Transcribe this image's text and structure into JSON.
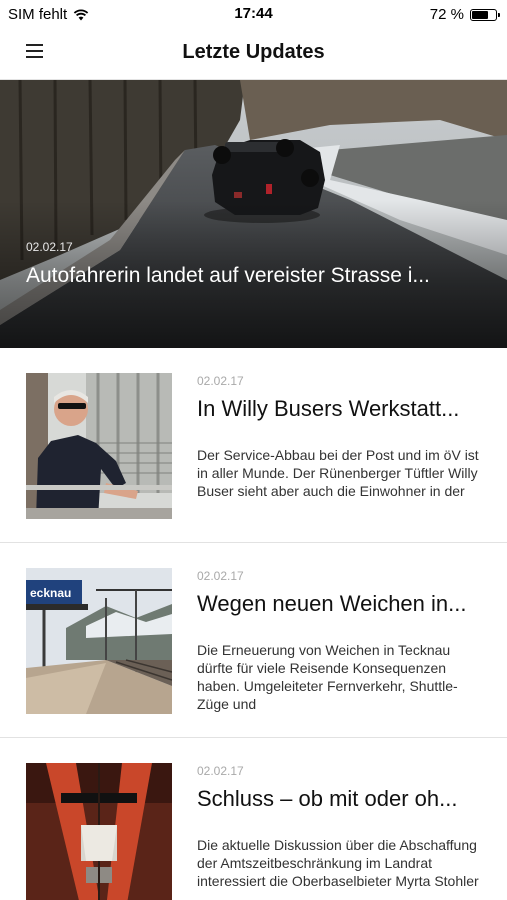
{
  "status_bar": {
    "carrier": "SIM fehlt",
    "time": "17:44",
    "battery": "72 %",
    "battery_level": 0.72,
    "icons": [
      "wifi-icon",
      "battery-icon"
    ]
  },
  "nav": {
    "title": "Letzte Updates",
    "menu_icon": "hamburger-menu-icon"
  },
  "hero": {
    "date": "02.02.17",
    "title": "Autofahrerin landet auf vereister Strasse i..."
  },
  "articles": [
    {
      "date": "02.02.17",
      "title": "In Willy Busers Werkstatt...",
      "text": "Der Service-Abbau bei der Post und im öV ist in aller Munde. Der Rünenberger Tüftler Willy Buser sieht aber auch die Einwohner in der"
    },
    {
      "date": "02.02.17",
      "title": "Wegen neuen Weichen in...",
      "text": "Die Erneuerung von Weichen in Tecknau dürfte für viele Reisende Konsequenzen haben. Umgeleiteter Fernverkehr, Shuttle-Züge und"
    },
    {
      "date": "02.02.17",
      "title": "Schluss – ob mit oder oh...",
      "text": "Die aktuelle Diskussion über die Abschaffung der Amtszeitbeschränkung im Landrat interessiert die Oberbaselbieter Myrta Stohler"
    }
  ],
  "thumb_texts": {
    "station_sign": "ecknau"
  }
}
